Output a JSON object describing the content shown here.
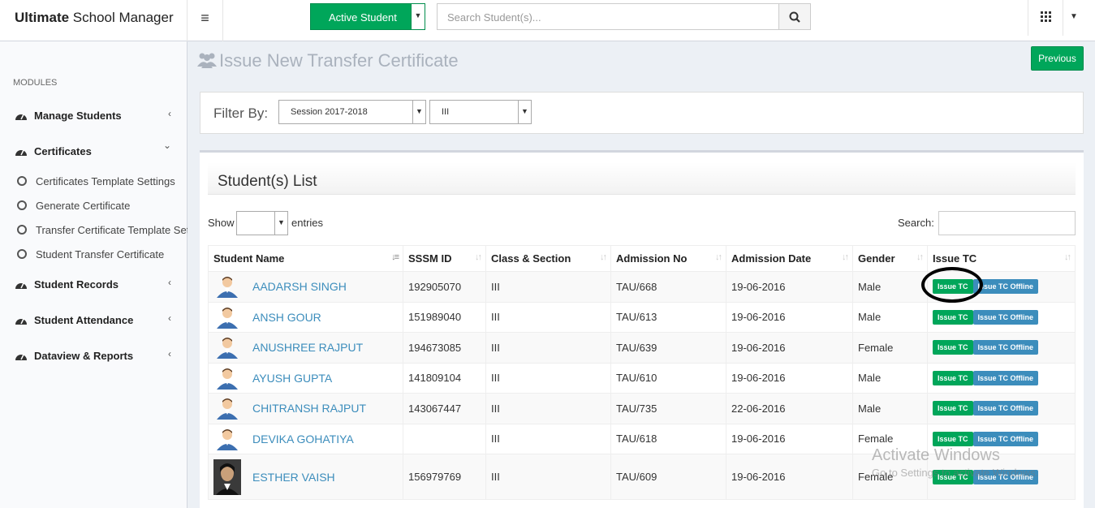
{
  "header": {
    "brand_bold": "Ultimate",
    "brand_rest": " School Manager",
    "active_student_label": "Active Student",
    "search_placeholder": "Search Student(s)..."
  },
  "sidebar": {
    "modules_label": "MODULES",
    "items": [
      {
        "label": "Manage Students",
        "arrow": "‹"
      },
      {
        "label": "Certificates",
        "arrow": "⌄"
      },
      {
        "label": "Student Records",
        "arrow": "‹"
      },
      {
        "label": "Student Attendance",
        "arrow": "‹"
      },
      {
        "label": "Dataview & Reports",
        "arrow": "‹"
      }
    ],
    "sub_items": [
      {
        "label": "Certificates Template Settings"
      },
      {
        "label": "Generate Certificate"
      },
      {
        "label": "Transfer Certificate Template Settings"
      },
      {
        "label": "Student Transfer Certificate"
      }
    ]
  },
  "page": {
    "title": "Issue New Transfer Certificate",
    "previous_label": "Previous",
    "filter_label": "Filter By:",
    "session_value": "Session 2017-2018",
    "class_value": "III",
    "list_title": "Student(s) List",
    "show_label": "Show",
    "entries_label": "entries",
    "search_label": "Search:"
  },
  "table": {
    "headers": [
      "Student Name",
      "SSSM ID",
      "Class & Section",
      "Admission No",
      "Admission Date",
      "Gender",
      "Issue TC"
    ],
    "issue_tc_label": "Issue TC",
    "issue_tc_offline_label": "Issue TC Offline",
    "rows": [
      {
        "name": "AADARSH SINGH",
        "sssm": "192905070",
        "class": "III",
        "adm_no": "TAU/668",
        "date": "19-06-2016",
        "gender": "Male"
      },
      {
        "name": "ANSH GOUR",
        "sssm": "151989040",
        "class": "III",
        "adm_no": "TAU/613",
        "date": "19-06-2016",
        "gender": "Male"
      },
      {
        "name": "ANUSHREE RAJPUT",
        "sssm": "194673085",
        "class": "III",
        "adm_no": "TAU/639",
        "date": "19-06-2016",
        "gender": "Female"
      },
      {
        "name": "AYUSH GUPTA",
        "sssm": "141809104",
        "class": "III",
        "adm_no": "TAU/610",
        "date": "19-06-2016",
        "gender": "Male"
      },
      {
        "name": "CHITRANSH RAJPUT",
        "sssm": "143067447",
        "class": "III",
        "adm_no": "TAU/735",
        "date": "22-06-2016",
        "gender": "Male"
      },
      {
        "name": "DEVIKA GOHATIYA",
        "sssm": "",
        "class": "III",
        "adm_no": "TAU/618",
        "date": "19-06-2016",
        "gender": "Female"
      },
      {
        "name": "ESTHER VAISH",
        "sssm": "156979769",
        "class": "III",
        "adm_no": "TAU/609",
        "date": "19-06-2016",
        "gender": "Female"
      }
    ]
  },
  "watermark": {
    "line1": "Activate Windows",
    "line2": "Go to Settings to activate Windows."
  },
  "colors": {
    "green": "#00a65a",
    "blue": "#3c8dbc"
  }
}
